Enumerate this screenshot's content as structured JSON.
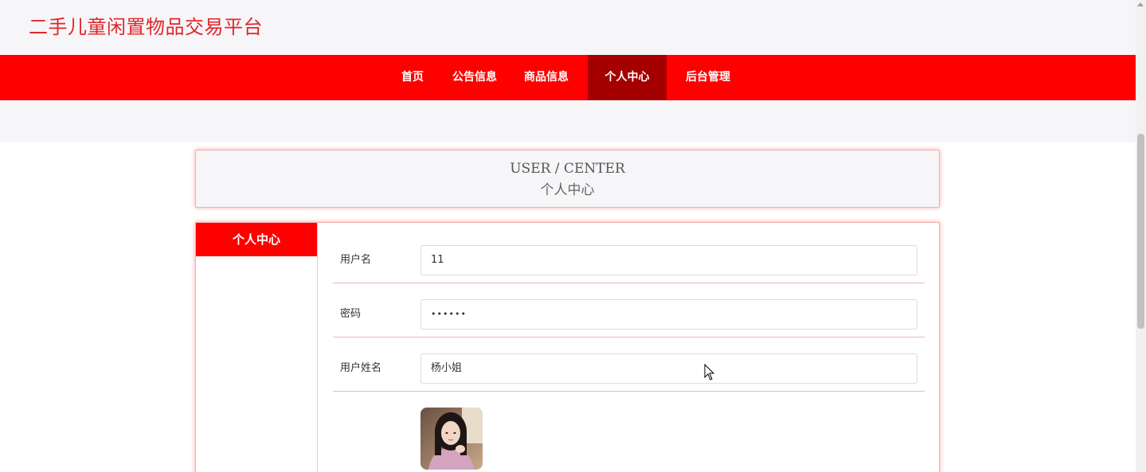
{
  "site": {
    "title": "二手儿童闲置物品交易平台"
  },
  "nav": {
    "items": [
      "首页",
      "公告信息",
      "商品信息",
      "个人中心",
      "后台管理"
    ],
    "active": "个人中心"
  },
  "header": {
    "en": "USER / CENTER",
    "cn": "个人中心"
  },
  "sidebar": {
    "tab_label": "个人中心"
  },
  "form": {
    "username": {
      "label": "用户名",
      "value": "11"
    },
    "password": {
      "label": "密码",
      "value": "••••••"
    },
    "fullname": {
      "label": "用户姓名",
      "value": "杨小姐"
    }
  },
  "colors": {
    "brand": "#ff0000",
    "active_nav": "#a50000",
    "title": "#e0262a"
  },
  "icons": {
    "cursor": "mouse-pointer-icon"
  }
}
